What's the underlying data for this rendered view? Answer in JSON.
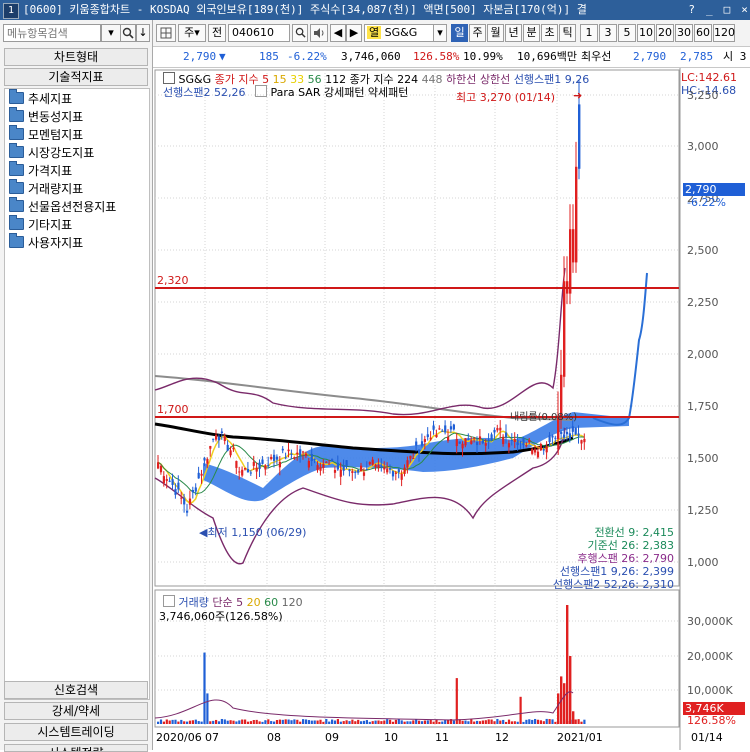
{
  "window": {
    "badge": "1",
    "title": "[0600] 키움종합차트 - KOSDAQ 외국인보유[189(천)] 주식수[34,087(천)] 액면[500] 자본금[170(억)] 결",
    "controls": [
      "?",
      "_",
      "□",
      "×"
    ]
  },
  "left_panel": {
    "search_placeholder": "메뉴항목검색",
    "search_buttons": [
      "▾",
      "🔍",
      "↓"
    ],
    "chart_type_label": "차트형태",
    "tech_label": "기술적지표",
    "tree_items": [
      "추세지표",
      "변동성지표",
      "모멘텀지표",
      "시장강도지표",
      "가격지표",
      "거래량지표",
      "선물옵션전용지표",
      "기타지표",
      "사용자지표"
    ],
    "bottom_buttons": [
      "신호검색",
      "강세/약세",
      "시스템트레이딩",
      "시스템전략"
    ]
  },
  "toolbar": {
    "period_label": "주",
    "prev_label": "전",
    "stock_code": "040610",
    "search_icon": "search-icon",
    "cond_label": "열",
    "stock_name": "SG&G",
    "period_tabs": [
      "일",
      "주",
      "월",
      "년",
      "분",
      "초",
      "틱"
    ],
    "active_tab": "일",
    "ranges": [
      "1",
      "3",
      "5",
      "10",
      "20",
      "30",
      "60",
      "120"
    ]
  },
  "quote": {
    "price": "2,790",
    "arrow": "▼",
    "change": "185",
    "change_pct": "-6.22%",
    "volume": "3,746,060",
    "volume_ratio": "126.58%",
    "turnover": "10.99%",
    "amount": "10,696백만",
    "best_label": "최우선",
    "best_bid": "2,790",
    "best_ask": "2,785",
    "extra": "시 3"
  },
  "legend": {
    "stock": "SG&G",
    "ma_label": "종가 지수 5",
    "ma_periods": [
      "15",
      "33",
      "56",
      "112"
    ],
    "ma_long_label": "종가 지수 224",
    "ma_long_value": "448",
    "hl_labels": [
      "하한선",
      "상한선"
    ],
    "span1": "선행스팬1 9,26",
    "span2": "선행스팬2 52,26",
    "psar": "Para SAR 강세패턴  약세패턴",
    "lc": "LC:142.61",
    "hc": "HC:-14.68"
  },
  "annotations": {
    "high": "최고 3,270 (01/14)",
    "low": "최저 1,150 (06/29)",
    "line_upper": "2,320",
    "line_lower": "1,700",
    "rate_note": "내림률(0.08%)"
  },
  "ichimoku": [
    {
      "label": "전환선 9: 2,415",
      "color": "#1b8a5a"
    },
    {
      "label": "기준선 26: 2,383",
      "color": "#1b8a5a"
    },
    {
      "label": "후행스팬 26: 2,790",
      "color": "#8a2b8a"
    },
    {
      "label": "선행스팬1 9,26: 2,399",
      "color": "#2a4fb0"
    },
    {
      "label": "선행스팬2 52,26: 2,310",
      "color": "#2a4fb0"
    }
  ],
  "price_axis": {
    "ticks": [
      "3,250",
      "3,000",
      "2,750",
      "2,500",
      "2,250",
      "2,000",
      "1,750",
      "1,500",
      "1,250",
      "1,000"
    ],
    "current": "2,790",
    "current_pct": "-6.22%"
  },
  "volume_panel": {
    "title": "거래량",
    "ma_label": "단순 5",
    "ma_periods": [
      "20",
      "60",
      "120"
    ],
    "value": "3,746,060주(126.58%)",
    "ticks": [
      "30,000K",
      "20,000K",
      "10,000K"
    ],
    "current": "3,746K",
    "current_pct": "126.58%"
  },
  "date_axis": {
    "labels": [
      "2020/06",
      "07",
      "08",
      "09",
      "10",
      "11",
      "12",
      "2021/01"
    ],
    "right_label": "01/14"
  },
  "colors": {
    "up": "#e02020",
    "down": "#1f5fd6",
    "hline": "#d01818",
    "cloud": "#3b7de8",
    "ma_long": "#000000",
    "ma_gray": "#8c8c8c",
    "bollinger": "#7a2a6a",
    "accent": "#2f63b5"
  }
}
